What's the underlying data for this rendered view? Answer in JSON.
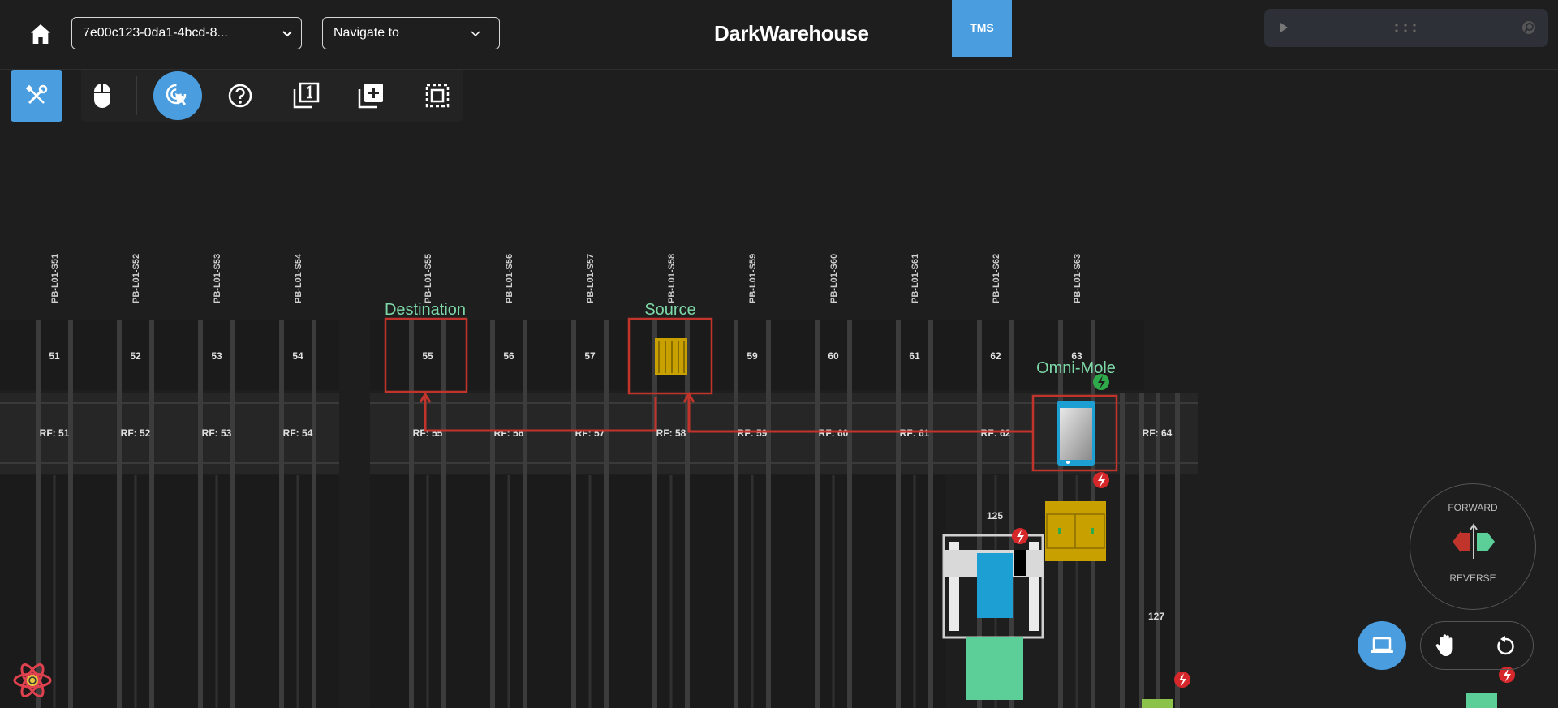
{
  "header": {
    "session_select_value": "7e00c123-0da1-4bcd-8...",
    "navigate_select_value": "Navigate to",
    "brand": "DarkWarehouse",
    "tms_button": "TMS"
  },
  "icons": {
    "home": "home-icon",
    "tools": "tools-icon",
    "mouse": "mouse-icon",
    "cursor_target": "cursor-target-icon",
    "help": "help-icon",
    "layer_one": "layer-one-icon",
    "add_layer": "add-layer-icon",
    "select_area": "select-area-icon",
    "play": "play-icon",
    "drag_handle": "drag-handle-icon",
    "search": "search-icon",
    "laptop": "laptop-icon",
    "hand": "hand-icon",
    "reset": "reset-icon",
    "react": "react-icon",
    "charging": "charging-icon"
  },
  "colors": {
    "accent": "#4a9ee0",
    "route": "#c0342b",
    "label_green": "#7dd8a8",
    "pallet_yellow": "#c8a000",
    "robot_blue": "#1e9fd4",
    "charge_red": "#d6282b",
    "charge_green": "#2faa4a"
  },
  "map": {
    "annotations": {
      "destination": "Destination",
      "source": "Source",
      "robot": "Omni-Mole"
    },
    "stations": [
      {
        "id": "PB-L01-S51",
        "num": "51",
        "rf": "RF: 51"
      },
      {
        "id": "PB-L01-S52",
        "num": "52",
        "rf": "RF: 52"
      },
      {
        "id": "PB-L01-S53",
        "num": "53",
        "rf": "RF: 53"
      },
      {
        "id": "PB-L01-S54",
        "num": "54",
        "rf": "RF: 54"
      },
      {
        "id": "PB-L01-S55",
        "num": "55",
        "rf": "RF: 55"
      },
      {
        "id": "PB-L01-S56",
        "num": "56",
        "rf": "RF: 56"
      },
      {
        "id": "PB-L01-S57",
        "num": "57",
        "rf": "RF: 57"
      },
      {
        "id": "PB-L01-S58",
        "num": "",
        "rf": "RF: 58"
      },
      {
        "id": "PB-L01-S59",
        "num": "59",
        "rf": "RF: 59"
      },
      {
        "id": "PB-L01-S60",
        "num": "60",
        "rf": "RF: 60"
      },
      {
        "id": "PB-L01-S61",
        "num": "61",
        "rf": "RF: 61"
      },
      {
        "id": "PB-L01-S62",
        "num": "62",
        "rf": "RF: 62"
      },
      {
        "id": "PB-L01-S63",
        "num": "63",
        "rf": ""
      }
    ],
    "extra_rf": "RF: 64",
    "bay_labels": [
      "125",
      "127"
    ]
  },
  "direction": {
    "forward": "FORWARD",
    "reverse": "REVERSE"
  }
}
